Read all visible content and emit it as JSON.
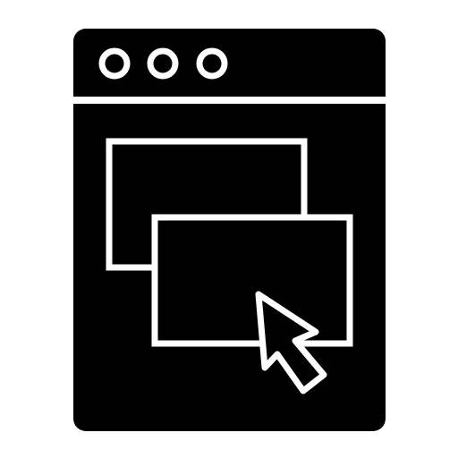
{
  "icon": {
    "name": "browser-window-drag-icon",
    "colors": {
      "foreground": "#000000",
      "background": "#ffffff"
    },
    "window_controls_count": 3
  }
}
